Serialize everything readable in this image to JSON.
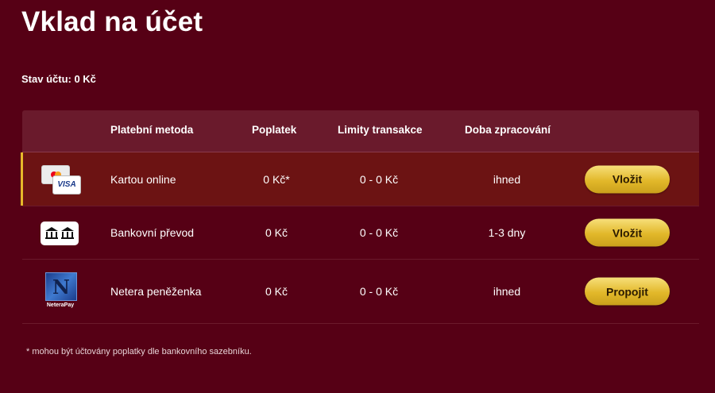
{
  "page": {
    "title": "Vklad na účet"
  },
  "balance": {
    "text": "Stav účtu: 0 Kč"
  },
  "table": {
    "headers": {
      "method": "Platební metoda",
      "fee": "Poplatek",
      "limits": "Limity transakce",
      "time": "Doba zpracování"
    },
    "rows": [
      {
        "icon": "card-icon",
        "name": "Kartou online",
        "fee": "0 Kč*",
        "limits": "0 - 0 Kč",
        "time": "ihned",
        "button": "Vložit",
        "icon_text_a": "MasterCard",
        "icon_text_b": "VISA"
      },
      {
        "icon": "bank-icon",
        "name": "Bankovní převod",
        "fee": "0 Kč",
        "limits": "0 - 0 Kč",
        "time": "1-3 dny",
        "button": "Vložit"
      },
      {
        "icon": "netera-icon",
        "name": "Netera peněženka",
        "fee": "0 Kč",
        "limits": "0 - 0 Kč",
        "time": "ihned",
        "button": "Propojit",
        "icon_letter": "N",
        "icon_text": "NeteraPay"
      }
    ]
  },
  "footnote": {
    "text": "* mohou být účtovány poplatky dle bankovního sazebníku."
  },
  "colors": {
    "background": "#560015",
    "accent": "#e6b92a",
    "header": "#6a1a2c",
    "active_row": "#6c1313"
  }
}
